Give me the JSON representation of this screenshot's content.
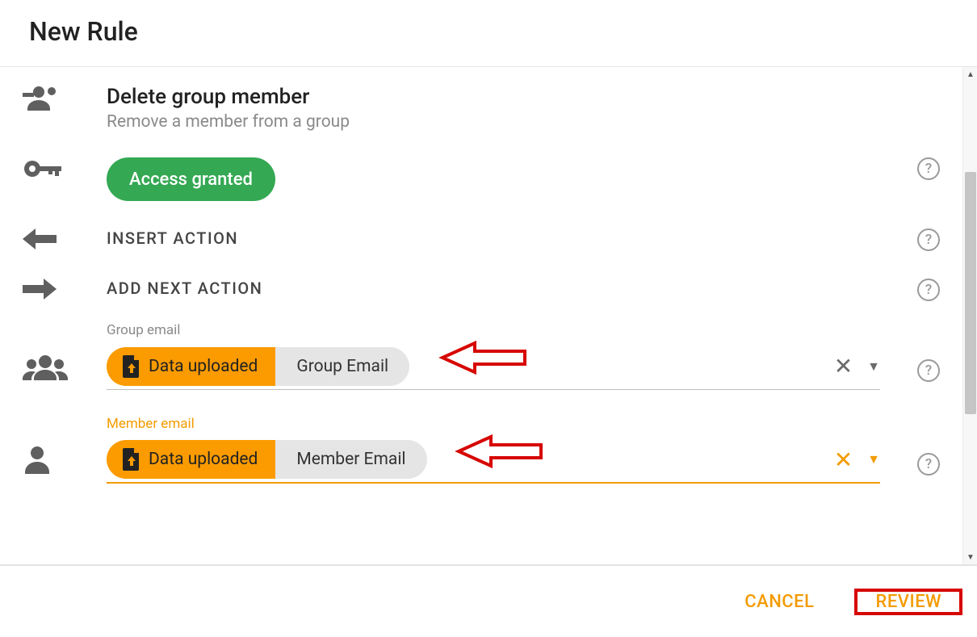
{
  "dialog": {
    "title": "New Rule"
  },
  "action_header": {
    "title": "Delete group member",
    "subtitle": "Remove a member from a group"
  },
  "access": {
    "chip": "Access granted"
  },
  "insert": {
    "label": "INSERT ACTION"
  },
  "add_next": {
    "label": "ADD NEXT ACTION"
  },
  "fields": [
    {
      "label": "Group email",
      "chip_left": "Data uploaded",
      "chip_right": "Group Email",
      "active": false
    },
    {
      "label": "Member email",
      "chip_left": "Data uploaded",
      "chip_right": "Member Email",
      "active": true
    }
  ],
  "footer": {
    "cancel": "CANCEL",
    "review": "REVIEW"
  },
  "colors": {
    "accent": "#f39b00",
    "green": "#34a853",
    "annotation": "#d60600"
  }
}
